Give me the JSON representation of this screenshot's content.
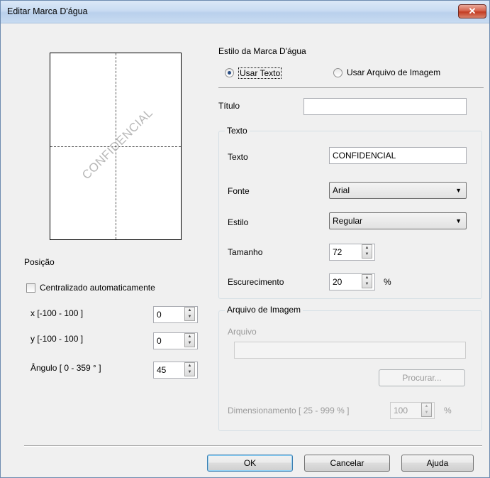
{
  "window": {
    "title": "Editar Marca D'água"
  },
  "preview": {
    "watermark_text": "CONFIDENCIAL"
  },
  "position": {
    "heading": "Posição",
    "auto_center_label": "Centralizado automaticamente",
    "auto_center_checked": false,
    "x": {
      "label": "x [-100  -  100 ]",
      "value": "0"
    },
    "y": {
      "label": "y [-100  -  100 ]",
      "value": "0"
    },
    "angle": {
      "label": "Ângulo [ 0 - 359 ° ]",
      "value": "45"
    }
  },
  "style": {
    "heading": "Estilo da Marca D'água",
    "use_text_label": "Usar Texto",
    "use_image_label": "Usar Arquivo de Imagem",
    "selected": "text"
  },
  "title_field": {
    "label": "Título",
    "value": ""
  },
  "text_group": {
    "title": "Texto",
    "text_label": "Texto",
    "text_value": "CONFIDENCIAL",
    "font_label": "Fonte",
    "font_value": "Arial",
    "style_label": "Estilo",
    "style_value": "Regular",
    "size_label": "Tamanho",
    "size_value": "72",
    "darkness_label": "Escurecimento",
    "darkness_value": "20",
    "darkness_unit": "%"
  },
  "image_group": {
    "title": "Arquivo de Imagem",
    "file_label": "Arquivo",
    "file_value": "",
    "browse_label": "Procurar...",
    "scale_label": "Dimensionamento [ 25 - 999 % ]",
    "scale_value": "100",
    "scale_unit": "%"
  },
  "buttons": {
    "ok": "OK",
    "cancel": "Cancelar",
    "help": "Ajuda"
  },
  "icons": {
    "close": "close-icon",
    "dropdown": "chevron-down-icon"
  },
  "colors": {
    "close_button": "#c94a34",
    "default_button_border": "#3c7fb1"
  }
}
